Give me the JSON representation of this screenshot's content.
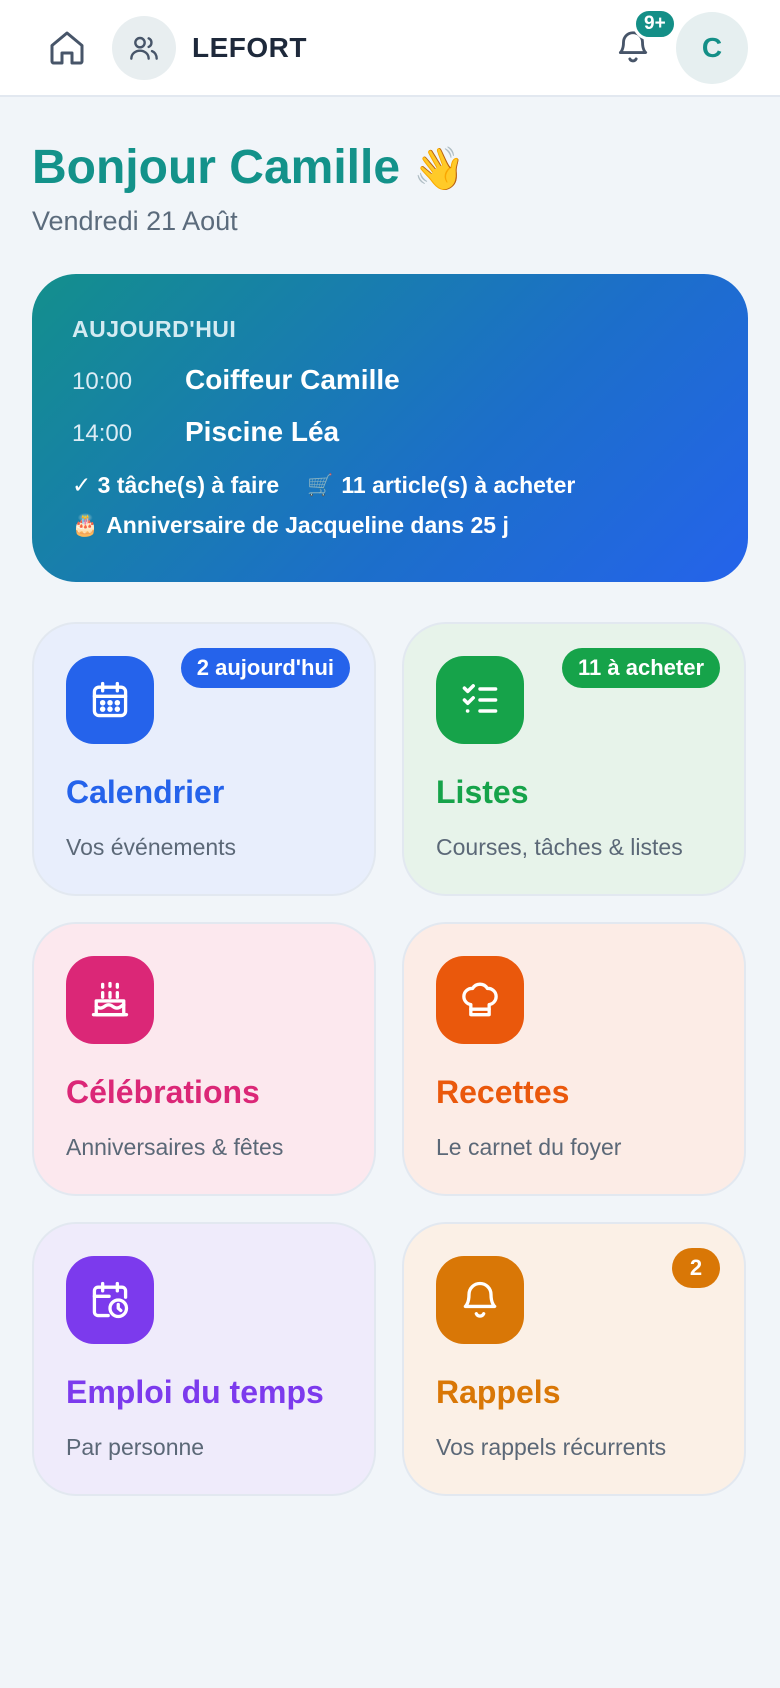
{
  "header": {
    "family_name": "LEFORT",
    "notifications_count": "9+",
    "avatar_initial": "C"
  },
  "greeting": {
    "title": "Bonjour Camille",
    "wave_emoji": "👋",
    "date": "Vendredi 21 Août"
  },
  "today": {
    "label": "AUJOURD'HUI",
    "events": [
      {
        "time": "10:00",
        "title": "Coiffeur Camille"
      },
      {
        "time": "14:00",
        "title": "Piscine Léa"
      }
    ],
    "tasks": "✓ 3 tâche(s) à faire",
    "cart_emoji": "🛒",
    "shopping": "11 article(s) à acheter",
    "cake_emoji": "🎂",
    "birthday": "Anniversaire de Jacqueline dans 25 j"
  },
  "tiles": [
    {
      "title": "Calendrier",
      "subtitle": "Vos événements",
      "badge": "2 aujourd'hui",
      "icon": "calendar-icon",
      "color": "#2563eb",
      "bg": "#e8eefc"
    },
    {
      "title": "Listes",
      "subtitle": "Courses, tâches & listes",
      "badge": "11 à acheter",
      "icon": "checklist-icon",
      "color": "#16a34a",
      "bg": "#e7f3ea"
    },
    {
      "title": "Célébrations",
      "subtitle": "Anniversaires & fêtes",
      "icon": "cake-icon",
      "color": "#db2777",
      "bg": "#fce8ee"
    },
    {
      "title": "Recettes",
      "subtitle": "Le carnet du foyer",
      "icon": "chef-hat-icon",
      "color": "#ea580c",
      "bg": "#fcece6"
    },
    {
      "title": "Emploi du temps",
      "subtitle": "Par personne",
      "icon": "calendar-clock-icon",
      "color": "#7c3aed",
      "bg": "#efebfb"
    },
    {
      "title": "Rappels",
      "subtitle": "Vos rappels récurrents",
      "badge": "2",
      "icon": "bell-icon",
      "color": "#d97706",
      "bg": "#fbf0e6"
    }
  ]
}
